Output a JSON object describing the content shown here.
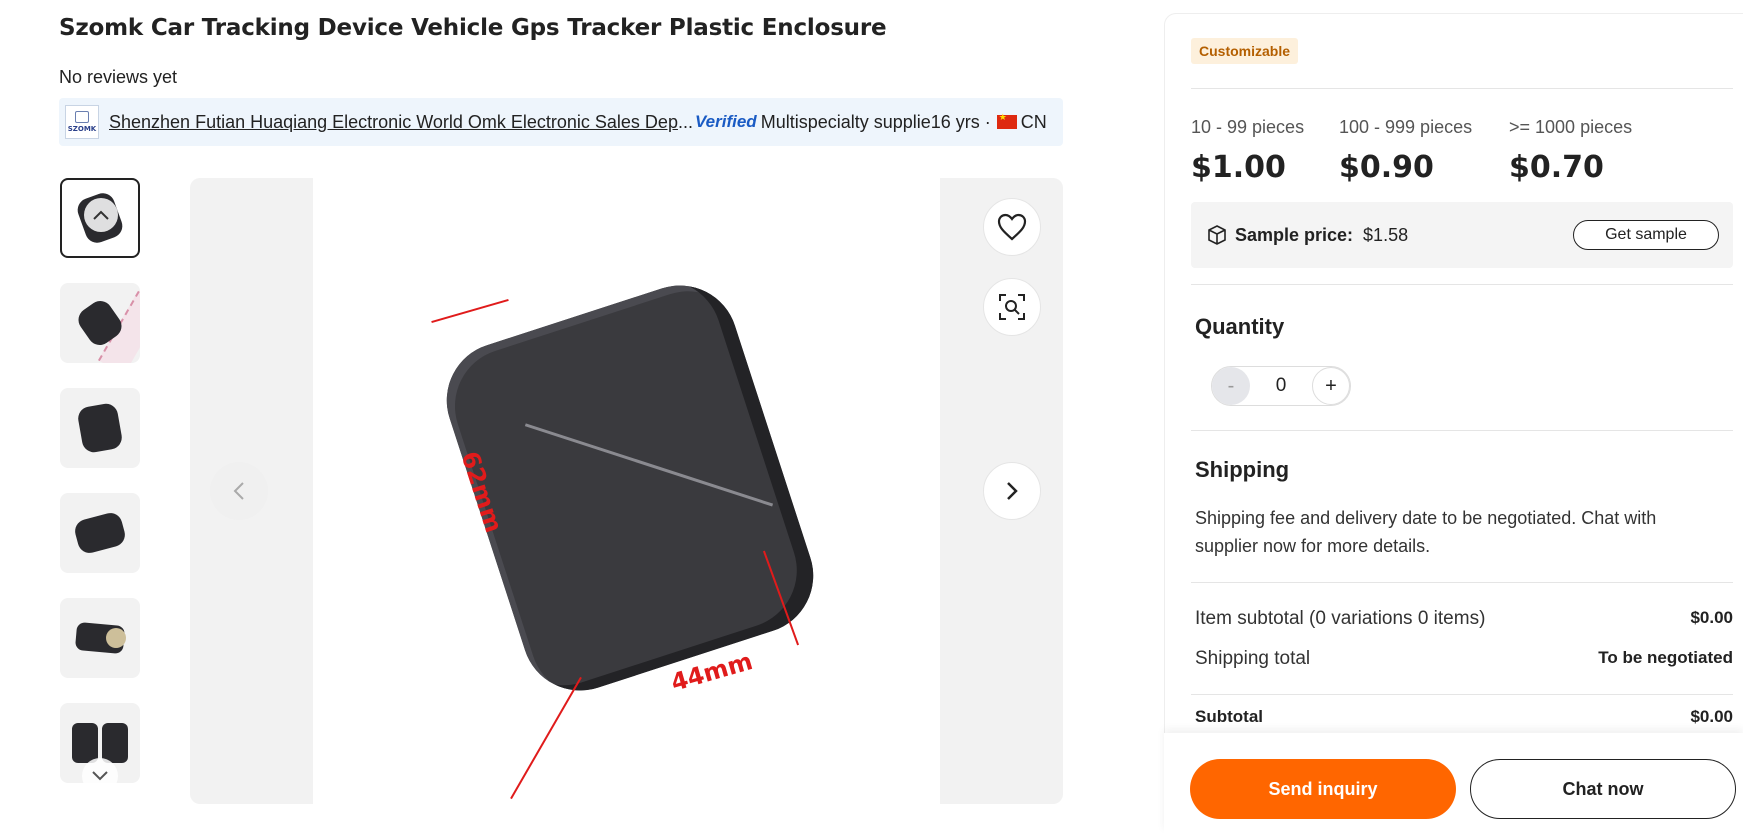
{
  "product": {
    "title": "Szomk Car Tracking Device Vehicle Gps Tracker Plastic Enclosure",
    "reviews": "No reviews yet"
  },
  "supplier": {
    "logo_text": "SZOMK",
    "name": "Shenzhen Futian Huaqiang Electronic World Omk Electronic Sales Dep",
    "ellipsis": "...",
    "verified": "Verified",
    "type": "Multispecialty supplie",
    "years": "16 yrs ·",
    "country": "CN"
  },
  "gallery": {
    "dimension_height": "62mm",
    "dimension_width": "44mm"
  },
  "panel": {
    "badge": "Customizable",
    "tiers": [
      {
        "qty": "10 - 99 pieces",
        "price": "$1.00"
      },
      {
        "qty": "100 - 999 pieces",
        "price": "$0.90"
      },
      {
        "qty": ">= 1000 pieces",
        "price": "$0.70"
      }
    ],
    "sample": {
      "label": "Sample price:",
      "value": "$1.58",
      "button": "Get sample"
    },
    "quantity": {
      "heading": "Quantity",
      "minus": "-",
      "value": "0",
      "plus": "+"
    },
    "shipping": {
      "heading": "Shipping",
      "text": "Shipping fee and delivery date to be negotiated. Chat with supplier now for more details."
    },
    "summary": {
      "item_subtotal_label": "Item subtotal (0 variations 0 items)",
      "item_subtotal_value": "$0.00",
      "shipping_total_label": "Shipping total",
      "shipping_total_value": "To be negotiated",
      "subtotal_label": "Subtotal",
      "subtotal_value": "$0.00"
    },
    "actions": {
      "inquiry": "Send inquiry",
      "chat": "Chat now"
    }
  },
  "colors": {
    "accent": "#ff6600",
    "badge_bg": "#fdf0dc",
    "badge_text": "#b45f00",
    "verified": "#1a5bc4"
  }
}
